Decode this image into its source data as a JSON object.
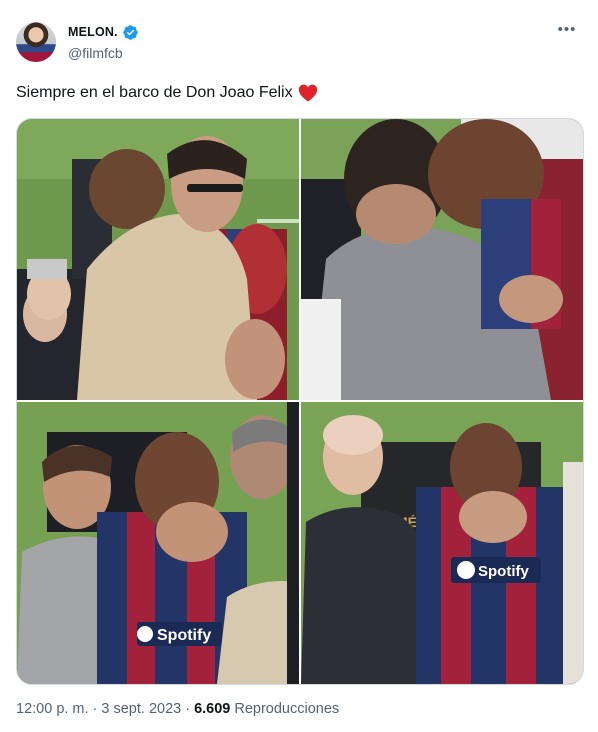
{
  "author": {
    "display_name": "MELON.",
    "handle": "@filmfcb",
    "verified": true
  },
  "tweet": {
    "text": "Siempre en el barco de Don Joao Felix",
    "emoji": "red-heart",
    "media": {
      "photos": [
        {
          "description": "man in beige shirt hugging player"
        },
        {
          "description": "man in grey shirt hugging player"
        },
        {
          "description": "player covering face in barca kit"
        },
        {
          "description": "player crying on pitch"
        }
      ],
      "shirt_sponsor_text": "Spotify",
      "board_text": "MÉS"
    },
    "time": "12:00 p. m.",
    "separator": "·",
    "date": "3 sept. 2023",
    "views_count": "6.609",
    "views_label": "Reproducciones"
  },
  "colors": {
    "verified_blue": "#1d9bf0",
    "heart_red": "#e0242f",
    "secondary_text": "#536471",
    "border": "#cfd9de"
  }
}
